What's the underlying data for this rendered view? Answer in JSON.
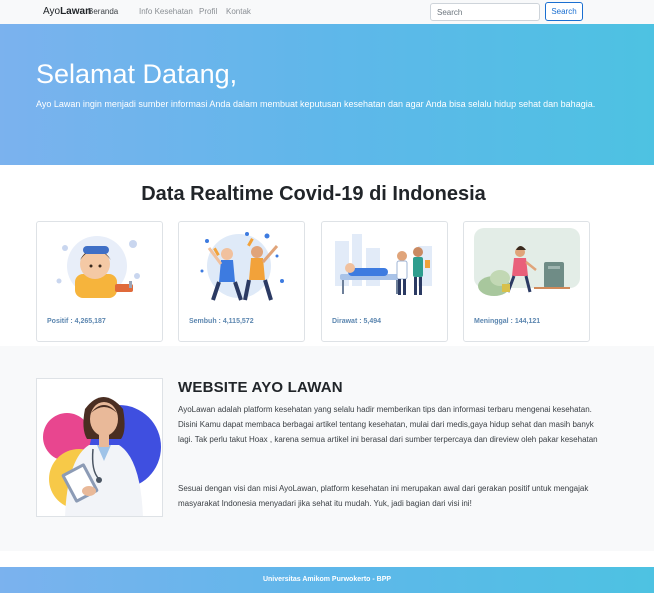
{
  "navbar": {
    "brand_prefix": "Ayo",
    "brand_bold": "Lawan",
    "links": [
      "Beranda",
      "Info Kesehatan",
      "Profil",
      "Kontak"
    ],
    "search_placeholder": "Search",
    "search_button": "Search"
  },
  "hero": {
    "title": "Selamat Datang,",
    "subtitle": "Ayo Lawan ingin menjadi sumber informasi Anda dalam membuat keputusan kesehatan dan agar Anda bisa selalu hidup sehat dan bahagia."
  },
  "stats": {
    "title": "Data Realtime Covid-19 di Indonesia",
    "cards": [
      {
        "label": "Positif : 4,265,187",
        "icon": "positive-illustration"
      },
      {
        "label": "Sembuh : 4,115,572",
        "icon": "recovered-illustration"
      },
      {
        "label": "Dirawat : 5,494",
        "icon": "hospitalized-illustration"
      },
      {
        "label": "Meninggal : 144,121",
        "icon": "deceased-illustration"
      }
    ]
  },
  "about": {
    "title": "WEBSITE AYO LAWAN",
    "paragraph1": "AyoLawan adalah platform kesehatan yang selalu hadir memberikan tips dan informasi terbaru mengenai kesehatan. Disini Kamu dapat membaca berbagai artikel tentang kesehatan, mulai dari medis,gaya hidup sehat dan masih banyk lagi. Tak perlu takut Hoax , karena semua artikel ini berasal dari sumber terpercaya dan direview oleh pakar kesehatan",
    "paragraph2": "Sesuai dengan visi dan misi AyoLawan, platform kesehatan ini merupakan awal dari gerakan positif untuk mengajak masyarakat Indonesia menyadari jika sehat itu mudah. Yuk, jadi bagian dari visi ini!"
  },
  "footer": {
    "text": "Universitas Amikom Purwokerto - BPP"
  },
  "colors": {
    "accent_start": "#7bb2ee",
    "accent_end": "#4dc2e2",
    "card_label": "#5d87b0",
    "button": "#1a6fd1"
  }
}
